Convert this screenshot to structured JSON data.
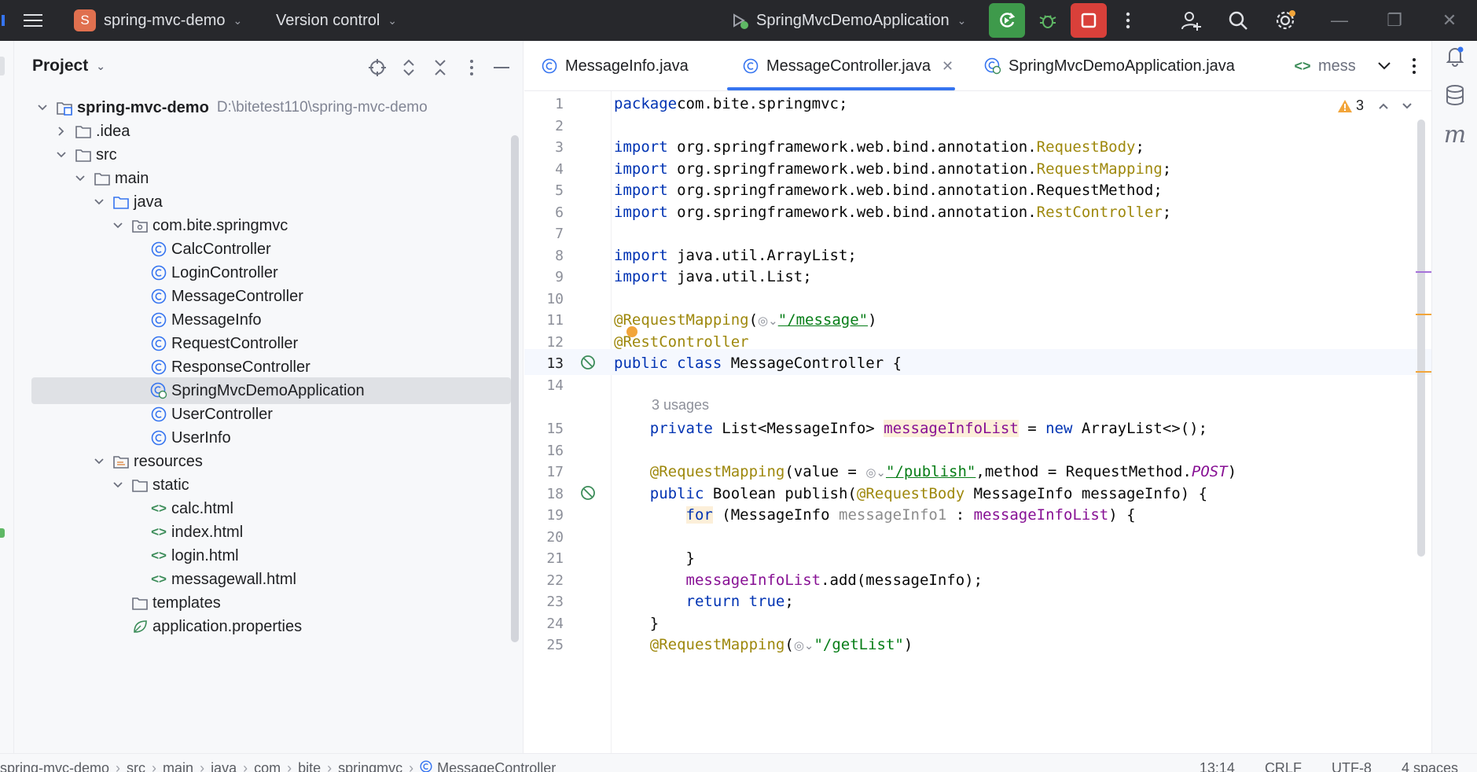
{
  "titlebar": {
    "project_badge": "S",
    "project_name": "spring-mvc-demo",
    "vcs_label": "Version control",
    "run_config": "SpringMvcDemoApplication"
  },
  "project_panel": {
    "title": "Project",
    "tree": [
      {
        "label": "spring-mvc-demo",
        "hint": "D:\\bitetest110\\spring-mvc-demo",
        "type": "module",
        "depth": 0,
        "expanded": true
      },
      {
        "label": ".idea",
        "type": "folder",
        "depth": 1,
        "expanded": false
      },
      {
        "label": "src",
        "type": "folder",
        "depth": 1,
        "expanded": true
      },
      {
        "label": "main",
        "type": "folder",
        "depth": 2,
        "expanded": true
      },
      {
        "label": "java",
        "type": "src-folder",
        "depth": 3,
        "expanded": true
      },
      {
        "label": "com.bite.springmvc",
        "type": "package",
        "depth": 4,
        "expanded": true
      },
      {
        "label": "CalcController",
        "type": "class",
        "depth": 5
      },
      {
        "label": "LoginController",
        "type": "class",
        "depth": 5
      },
      {
        "label": "MessageController",
        "type": "class",
        "depth": 5
      },
      {
        "label": "MessageInfo",
        "type": "class",
        "depth": 5
      },
      {
        "label": "RequestController",
        "type": "class",
        "depth": 5
      },
      {
        "label": "ResponseController",
        "type": "class",
        "depth": 5
      },
      {
        "label": "SpringMvcDemoApplication",
        "type": "boot-class",
        "depth": 5,
        "selected": true
      },
      {
        "label": "UserController",
        "type": "class",
        "depth": 5
      },
      {
        "label": "UserInfo",
        "type": "class",
        "depth": 5
      },
      {
        "label": "resources",
        "type": "res-folder",
        "depth": 3,
        "expanded": true
      },
      {
        "label": "static",
        "type": "folder",
        "depth": 4,
        "expanded": true
      },
      {
        "label": "calc.html",
        "type": "html",
        "depth": 5
      },
      {
        "label": "index.html",
        "type": "html",
        "depth": 5
      },
      {
        "label": "login.html",
        "type": "html",
        "depth": 5
      },
      {
        "label": "messagewall.html",
        "type": "html",
        "depth": 5
      },
      {
        "label": "templates",
        "type": "folder",
        "depth": 4
      },
      {
        "label": "application.properties",
        "type": "properties",
        "depth": 4
      }
    ]
  },
  "tabs": [
    {
      "label": "MessageInfo.java",
      "active": false
    },
    {
      "label": "MessageController.java",
      "active": true
    },
    {
      "label": "SpringMvcDemoApplication.java",
      "active": false
    },
    {
      "label": "mess",
      "active": false
    }
  ],
  "editor": {
    "warning_count": "3",
    "usages_hint": "3 usages",
    "lines": [
      {
        "n": "1",
        "segs": [
          [
            "kw",
            "package"
          ],
          [
            "",
            "com.bite.springmvc;"
          ]
        ]
      },
      {
        "n": "2",
        "segs": []
      },
      {
        "n": "3",
        "segs": [
          [
            "kw",
            "import "
          ],
          [
            "",
            "org.springframework.web.bind.annotation."
          ],
          [
            "ann",
            "RequestBody"
          ],
          [
            "",
            ";"
          ]
        ]
      },
      {
        "n": "4",
        "segs": [
          [
            "kw",
            "import "
          ],
          [
            "",
            "org.springframework.web.bind.annotation."
          ],
          [
            "ann",
            "RequestMapping"
          ],
          [
            "",
            ";"
          ]
        ]
      },
      {
        "n": "5",
        "segs": [
          [
            "kw",
            "import "
          ],
          [
            "",
            "org.springframework.web.bind.annotation.RequestMethod;"
          ]
        ]
      },
      {
        "n": "6",
        "segs": [
          [
            "kw",
            "import "
          ],
          [
            "",
            "org.springframework.web.bind.annotation."
          ],
          [
            "ann",
            "RestController"
          ],
          [
            "",
            ";"
          ]
        ]
      },
      {
        "n": "7",
        "segs": []
      },
      {
        "n": "8",
        "segs": [
          [
            "kw",
            "import "
          ],
          [
            "",
            "java.util.ArrayList;"
          ]
        ]
      },
      {
        "n": "9",
        "segs": [
          [
            "kw",
            "import "
          ],
          [
            "",
            "java.util.List;"
          ]
        ]
      },
      {
        "n": "10",
        "segs": []
      },
      {
        "n": "11",
        "segs": [
          [
            "ann",
            "@RequestMapping"
          ],
          [
            "",
            "("
          ],
          [
            "globe",
            ""
          ],
          [
            "str link",
            "\"/message\""
          ],
          [
            "",
            ")"
          ]
        ]
      },
      {
        "n": "12",
        "segs": [
          [
            "ann",
            "@RestController"
          ]
        ]
      },
      {
        "n": "13",
        "segs": [
          [
            "kw",
            "public class "
          ],
          [
            "",
            "MessageController {"
          ]
        ]
      },
      {
        "n": "14",
        "segs": []
      },
      {
        "n": "15",
        "segs": [
          [
            "",
            "    "
          ],
          [
            "kw",
            "private "
          ],
          [
            "",
            "List<MessageInfo> "
          ],
          [
            "fld hl",
            "messageInfoList"
          ],
          [
            "",
            " = "
          ],
          [
            "kw",
            "new "
          ],
          [
            "",
            "ArrayList<>();"
          ]
        ]
      },
      {
        "n": "16",
        "segs": []
      },
      {
        "n": "17",
        "segs": [
          [
            "",
            "    "
          ],
          [
            "ann",
            "@RequestMapping"
          ],
          [
            "",
            "(value = "
          ],
          [
            "globe",
            ""
          ],
          [
            "str link",
            "\"/publish\""
          ],
          [
            "",
            ",method = RequestMethod."
          ],
          [
            "fld it",
            "POST"
          ],
          [
            "",
            ")"
          ]
        ]
      },
      {
        "n": "18",
        "segs": [
          [
            "",
            "    "
          ],
          [
            "kw",
            "public "
          ],
          [
            "",
            "Boolean publish("
          ],
          [
            "ann",
            "@RequestBody"
          ],
          [
            "",
            " MessageInfo messageInfo) {"
          ]
        ]
      },
      {
        "n": "19",
        "segs": [
          [
            "",
            "        "
          ],
          [
            "kw hl",
            "for"
          ],
          [
            "",
            " (MessageInfo "
          ],
          [
            "unused",
            "messageInfo1"
          ],
          [
            "",
            " : "
          ],
          [
            "fld",
            "messageInfoList"
          ],
          [
            "",
            ") {"
          ]
        ]
      },
      {
        "n": "20",
        "segs": []
      },
      {
        "n": "21",
        "segs": [
          [
            "",
            "        }"
          ]
        ]
      },
      {
        "n": "22",
        "segs": [
          [
            "",
            "        "
          ],
          [
            "fld",
            "messageInfoList"
          ],
          [
            "",
            ".add(messageInfo);"
          ]
        ]
      },
      {
        "n": "23",
        "segs": [
          [
            "",
            "        "
          ],
          [
            "kw",
            "return true"
          ],
          [
            "",
            ";"
          ]
        ]
      },
      {
        "n": "24",
        "segs": [
          [
            "",
            "    }"
          ]
        ]
      },
      {
        "n": "25",
        "segs": [
          [
            "",
            "    "
          ],
          [
            "ann",
            "@RequestMapping"
          ],
          [
            "",
            "("
          ],
          [
            "globe",
            ""
          ],
          [
            "str",
            "\"/getList\""
          ],
          [
            "",
            ")"
          ]
        ]
      }
    ]
  },
  "statusbar": {
    "breadcrumbs": [
      "spring-mvc-demo",
      "src",
      "main",
      "java",
      "com",
      "bite",
      "springmvc",
      "MessageController"
    ],
    "position": "13:14",
    "line_sep": "CRLF",
    "encoding": "UTF-8",
    "indent": "4 spaces"
  },
  "colors": {
    "titlebar_bg": "#27282c",
    "run_green": "#3e9a4b",
    "stop_red": "#d9403a",
    "accent_blue": "#3574f0",
    "keyword": "#0033b3",
    "annotation": "#9e880d",
    "string": "#067d17",
    "field": "#871094"
  }
}
